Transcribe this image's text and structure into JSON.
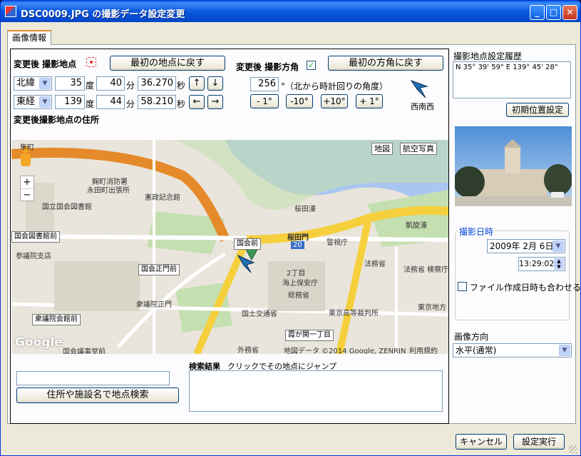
{
  "window": {
    "title": "DSC0009.JPG の撮影データ設定変更"
  },
  "tab": {
    "label": "画像情報"
  },
  "location": {
    "heading": "変更後 撮影地点",
    "reset_button": "最初の地点に戻す",
    "lat": {
      "dir": "北緯",
      "deg": "35",
      "min": "40",
      "sec": "36.270"
    },
    "lon": {
      "dir": "東経",
      "deg": "139",
      "min": "44",
      "sec": "58.210"
    },
    "unit_deg": "度",
    "unit_min": "分",
    "unit_sec": "秒",
    "arrows": {
      "up": "↑",
      "down": "↓",
      "left": "←",
      "right": "→"
    },
    "address_label": "変更後撮影地点の住所"
  },
  "direction": {
    "heading": "変更後 撮影方角",
    "checked": true,
    "reset_button": "最初の方角に戻す",
    "value": "256",
    "note": "°（北から時計回りの角度）",
    "buttons": [
      "- 1°",
      "-10°",
      "+10°",
      "+ 1°"
    ],
    "compass_label": "西南西"
  },
  "map": {
    "type_buttons": [
      "地図",
      "航空写真"
    ],
    "zoom_in": "+",
    "zoom_out": "−",
    "labels": [
      "隼町",
      "麹町消防署",
      "永田町出張所",
      "憲政記念館",
      "国立国会図書館",
      "国会図書館前",
      "参議院支店",
      "国会前",
      "桜田濠",
      "桜田門",
      "警視庁",
      "凱旋濠",
      "20",
      "国会正門前",
      "2丁目",
      "海上保安庁",
      "総務省",
      "法務省",
      "法務省 検察庁",
      "衆議院正門",
      "国土交通省",
      "東京高等裁判所",
      "東京地方",
      "衆議院会館前",
      "霞が関一丁目",
      "国会議事堂前",
      "外務省"
    ],
    "copyright": "地図データ ©2014 Google, ZENRIN",
    "terms": "利用規約",
    "logo": "Google"
  },
  "search": {
    "input_value": "",
    "button": "住所や施設名で地点検索",
    "results_label": "検索結果",
    "results_hint": "クリックでその地点にジャンプ"
  },
  "history": {
    "label": "撮影地点設定履歴",
    "entry": "N 35° 39' 59\"  E 139° 45' 28\"",
    "init_button": "初期位置設定"
  },
  "datetime": {
    "group": "撮影日時",
    "date": "2009年  2月  6日",
    "time": "13:29:02",
    "match_label": "ファイル作成日時も合わせる",
    "match_checked": false
  },
  "orientation": {
    "label": "画像方向",
    "value": "水平(通常)"
  },
  "footer": {
    "cancel": "キャンセル",
    "apply": "設定実行"
  },
  "colors": {
    "titlebar": "#0a57e0",
    "panel": "#ece9d8",
    "road_yellow": "#f6cf3c",
    "road_orange": "#e58a2a",
    "water": "#a9c6f0",
    "park": "#c4dfb0"
  }
}
